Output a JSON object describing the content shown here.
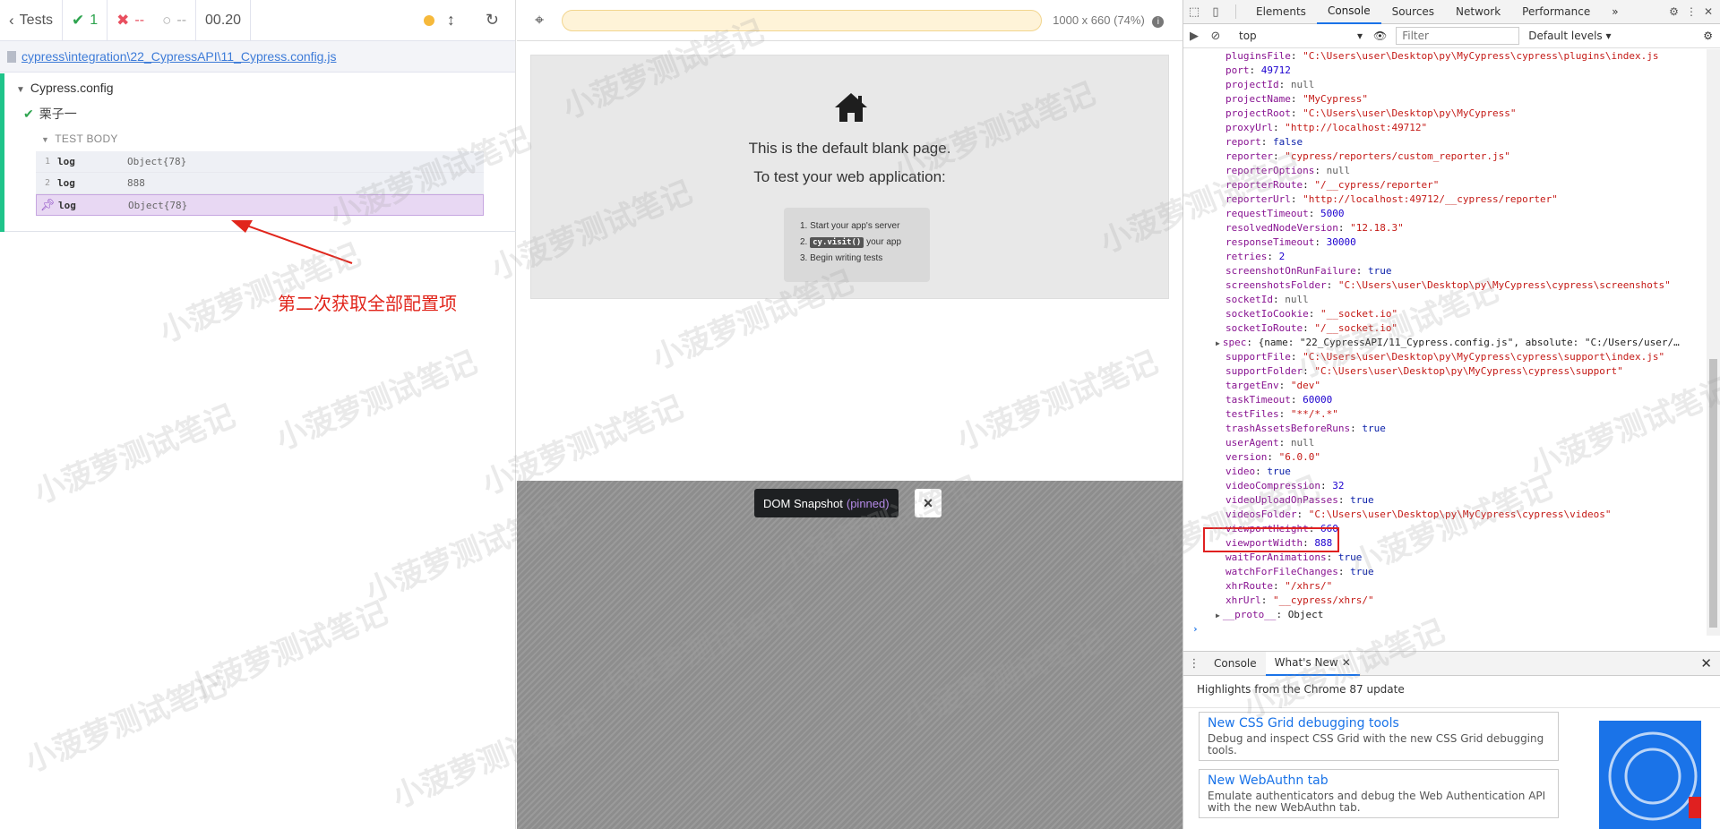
{
  "reporter": {
    "back_label": "Tests",
    "passed_count": "1",
    "failed_count": "--",
    "pending_count": "--",
    "duration": "00.20",
    "spec_path": "cypress\\integration\\22_CypressAPI\\11_Cypress.config.js",
    "suite_title": "Cypress.config",
    "test_title": "栗子一",
    "body_label": "TEST BODY",
    "commands": [
      {
        "num": "1",
        "name": "log",
        "message": "Object{78}"
      },
      {
        "num": "2",
        "name": "log",
        "message": "888"
      },
      {
        "num": "",
        "name": "log",
        "message": "Object{78}"
      }
    ],
    "annotation": "第二次获取全部配置项"
  },
  "aut": {
    "viewport": "1000 x 660",
    "scale": "(74%)",
    "blank_line1": "This is the default blank page.",
    "blank_line2": "To test your web application:",
    "step1": "1. Start your app's server",
    "step2_prefix": "2.",
    "step2_code": "cy.visit()",
    "step2_suffix": "your app",
    "step3": "3. Begin writing tests",
    "snapshot_label": "DOM Snapshot",
    "snapshot_state": "(pinned)",
    "snapshot_close": "×"
  },
  "devtools": {
    "tabs": [
      "Elements",
      "Console",
      "Sources",
      "Network",
      "Performance"
    ],
    "active_tab": "Console",
    "context": "top",
    "filter_placeholder": "Filter",
    "levels": "Default levels ▾",
    "lines": [
      {
        "k": "pluginsFile",
        "v": "\"C:\\Users\\user\\Desktop\\py\\MyCypress\\cypress\\plugins\\index.js",
        "t": "s"
      },
      {
        "k": "port",
        "v": "49712",
        "t": "n"
      },
      {
        "k": "projectId",
        "v": "null",
        "t": "null"
      },
      {
        "k": "projectName",
        "v": "\"MyCypress\"",
        "t": "s"
      },
      {
        "k": "projectRoot",
        "v": "\"C:\\Users\\user\\Desktop\\py\\MyCypress\"",
        "t": "s"
      },
      {
        "k": "proxyUrl",
        "v": "\"http://localhost:49712\"",
        "t": "s"
      },
      {
        "k": "report",
        "v": "false",
        "t": "b"
      },
      {
        "k": "reporter",
        "v": "\"cypress/reporters/custom_reporter.js\"",
        "t": "s"
      },
      {
        "k": "reporterOptions",
        "v": "null",
        "t": "null"
      },
      {
        "k": "reporterRoute",
        "v": "\"/__cypress/reporter\"",
        "t": "s"
      },
      {
        "k": "reporterUrl",
        "v": "\"http://localhost:49712/__cypress/reporter\"",
        "t": "s"
      },
      {
        "k": "requestTimeout",
        "v": "5000",
        "t": "n"
      },
      {
        "k": "resolvedNodeVersion",
        "v": "\"12.18.3\"",
        "t": "s"
      },
      {
        "k": "responseTimeout",
        "v": "30000",
        "t": "n"
      },
      {
        "k": "retries",
        "v": "2",
        "t": "n"
      },
      {
        "k": "screenshotOnRunFailure",
        "v": "true",
        "t": "b"
      },
      {
        "k": "screenshotsFolder",
        "v": "\"C:\\Users\\user\\Desktop\\py\\MyCypress\\cypress\\screenshots\"",
        "t": "s"
      },
      {
        "k": "socketId",
        "v": "null",
        "t": "null"
      },
      {
        "k": "socketIoCookie",
        "v": "\"__socket.io\"",
        "t": "s"
      },
      {
        "k": "socketIoRoute",
        "v": "\"/__socket.io\"",
        "t": "s"
      },
      {
        "k": "spec",
        "v": "{name: \"22_CypressAPI/11_Cypress.config.js\", absolute: \"C:/Users/user/…",
        "t": "obj",
        "exp": true
      },
      {
        "k": "supportFile",
        "v": "\"C:\\Users\\user\\Desktop\\py\\MyCypress\\cypress\\support\\index.js\"",
        "t": "s"
      },
      {
        "k": "supportFolder",
        "v": "\"C:\\Users\\user\\Desktop\\py\\MyCypress\\cypress\\support\"",
        "t": "s"
      },
      {
        "k": "targetEnv",
        "v": "\"dev\"",
        "t": "s"
      },
      {
        "k": "taskTimeout",
        "v": "60000",
        "t": "n"
      },
      {
        "k": "testFiles",
        "v": "\"**/*.*\"",
        "t": "s"
      },
      {
        "k": "trashAssetsBeforeRuns",
        "v": "true",
        "t": "b"
      },
      {
        "k": "userAgent",
        "v": "null",
        "t": "null"
      },
      {
        "k": "version",
        "v": "\"6.0.0\"",
        "t": "s"
      },
      {
        "k": "video",
        "v": "true",
        "t": "b"
      },
      {
        "k": "videoCompression",
        "v": "32",
        "t": "n"
      },
      {
        "k": "videoUploadOnPasses",
        "v": "true",
        "t": "b"
      },
      {
        "k": "videosFolder",
        "v": "\"C:\\Users\\user\\Desktop\\py\\MyCypress\\cypress\\videos\"",
        "t": "s"
      },
      {
        "k": "viewportHeight",
        "v": "660",
        "t": "n"
      },
      {
        "k": "viewportWidth",
        "v": "888",
        "t": "n"
      },
      {
        "k": "waitForAnimations",
        "v": "true",
        "t": "b"
      },
      {
        "k": "watchForFileChanges",
        "v": "true",
        "t": "b"
      },
      {
        "k": "xhrRoute",
        "v": "\"/xhrs/\"",
        "t": "s"
      },
      {
        "k": "xhrUrl",
        "v": "\"__cypress/xhrs/\"",
        "t": "s"
      },
      {
        "k": "__proto__",
        "v": "Object",
        "t": "proto",
        "exp": true
      }
    ],
    "drawer_tabs": [
      "Console",
      "What's New"
    ],
    "drawer_active": "What's New",
    "highlights_title": "Highlights from the Chrome 87 update",
    "features": [
      {
        "title": "New CSS Grid debugging tools",
        "desc": "Debug and inspect CSS Grid with the new CSS Grid debugging tools."
      },
      {
        "title": "New WebAuthn tab",
        "desc": "Emulate authenticators and debug the Web Authentication API with the new WebAuthn tab."
      }
    ]
  },
  "watermark": "小菠萝测试笔记",
  "colors": {
    "pass": "#2ea44f",
    "fail": "#e94f5f",
    "pinned": "#8e4ec6",
    "annotation": "#e1251b",
    "devtools_accent": "#1a73e8"
  }
}
